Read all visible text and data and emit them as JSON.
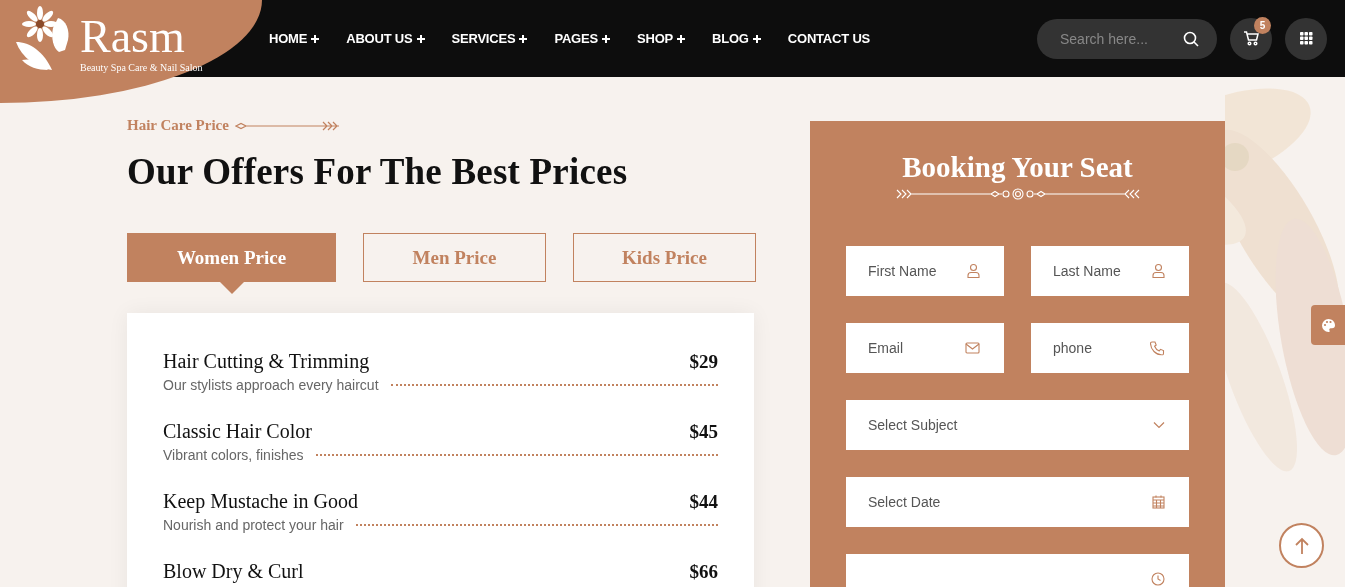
{
  "logo": {
    "name": "Rasm",
    "tagline": "Beauty Spa Care & Nail Salon"
  },
  "nav": [
    {
      "label": "HOME",
      "has_submenu": true
    },
    {
      "label": "ABOUT US",
      "has_submenu": true
    },
    {
      "label": "SERVICES",
      "has_submenu": true
    },
    {
      "label": "PAGES",
      "has_submenu": true
    },
    {
      "label": "SHOP",
      "has_submenu": true
    },
    {
      "label": "BLOG",
      "has_submenu": true
    },
    {
      "label": "CONTACT US",
      "has_submenu": false
    }
  ],
  "search": {
    "placeholder": "Search here..."
  },
  "cart": {
    "count": "5"
  },
  "section": {
    "eyebrow": "Hair Care Price",
    "title": "Our Offers For The Best Prices"
  },
  "tabs": [
    {
      "label": "Women Price",
      "selected": true
    },
    {
      "label": "Men Price",
      "selected": false
    },
    {
      "label": "Kids Price",
      "selected": false
    }
  ],
  "prices": [
    {
      "name": "Hair Cutting & Trimming",
      "description": "Our stylists approach every haircut",
      "price": "$29"
    },
    {
      "name": "Classic Hair Color",
      "description": "Vibrant colors, finishes",
      "price": "$45"
    },
    {
      "name": "Keep Mustache in Good",
      "description": "Nourish and protect your hair",
      "price": "$44"
    },
    {
      "name": "Blow Dry & Curl",
      "price": "$66"
    }
  ],
  "booking": {
    "title": "Booking Your Seat",
    "fields": [
      {
        "kind": "first",
        "placeholder": "First Name"
      },
      {
        "kind": "last",
        "placeholder": "Last Name"
      },
      {
        "kind": "email",
        "placeholder": "Email"
      },
      {
        "kind": "phone",
        "placeholder": "phone"
      },
      {
        "kind": "select",
        "placeholder": "Select Subject"
      },
      {
        "kind": "date",
        "placeholder": "Select Date"
      },
      {
        "kind": "time"
      }
    ]
  }
}
